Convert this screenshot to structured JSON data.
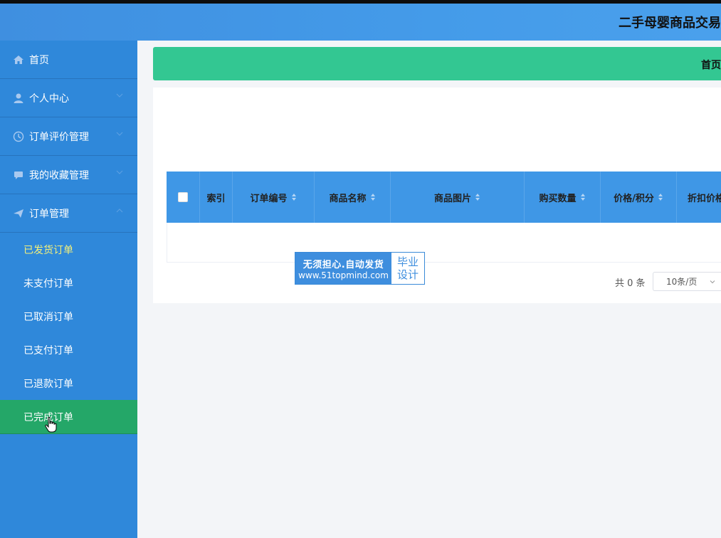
{
  "app": {
    "title": "二手母婴商品交易"
  },
  "breadcrumb": {
    "text": "首页"
  },
  "sidebar": {
    "items": [
      {
        "label": "首页",
        "icon": "home-icon"
      },
      {
        "label": "个人中心",
        "icon": "user-icon"
      },
      {
        "label": "订单评价管理",
        "icon": "clock-icon"
      },
      {
        "label": "我的收藏管理",
        "icon": "chat-icon"
      },
      {
        "label": "订单管理",
        "icon": "send-icon"
      }
    ],
    "submenu": [
      {
        "label": "已发货订单"
      },
      {
        "label": "未支付订单"
      },
      {
        "label": "已取消订单"
      },
      {
        "label": "已支付订单"
      },
      {
        "label": "已退款订单"
      },
      {
        "label": "已完成订单"
      }
    ]
  },
  "table": {
    "columns": [
      "索引",
      "订单编号",
      "商品名称",
      "商品图片",
      "购买数量",
      "价格/积分",
      "折扣价格"
    ]
  },
  "pager": {
    "total": "共 0 条",
    "page_size": "10条/页"
  },
  "watermark": {
    "line1": "无须担心.自动发货",
    "line2": "www.51topmind.com",
    "right1": "毕业",
    "right2": "设计"
  },
  "colors": {
    "header": "#449be9",
    "sidebar": "#2f88da",
    "breadcrumb_bar": "#33c792",
    "active_item": "#24a768",
    "current_item_text": "#f4f07a"
  }
}
